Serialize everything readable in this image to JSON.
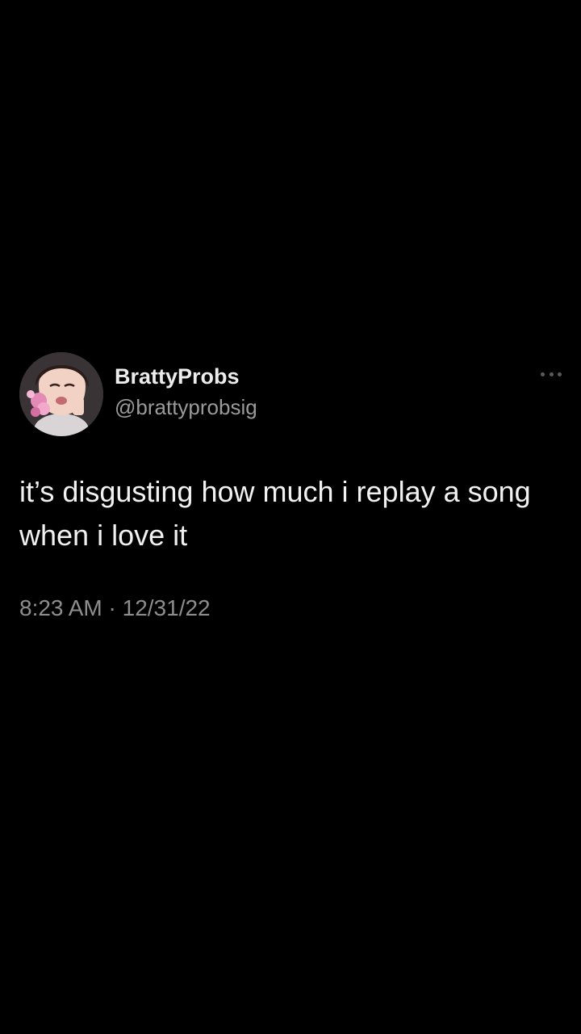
{
  "tweet": {
    "display_name": "BrattyProbs",
    "handle": "@brattyprobsig",
    "text": "it’s disgusting how much i replay a song when i love it",
    "time": "8:23 AM",
    "separator": "·",
    "date": "12/31/22",
    "more_icon": "more-horizontal-icon"
  },
  "colors": {
    "background": "#000000",
    "name": "#ececec",
    "secondary": "#9a9a9a",
    "text": "#f1f1f1"
  }
}
